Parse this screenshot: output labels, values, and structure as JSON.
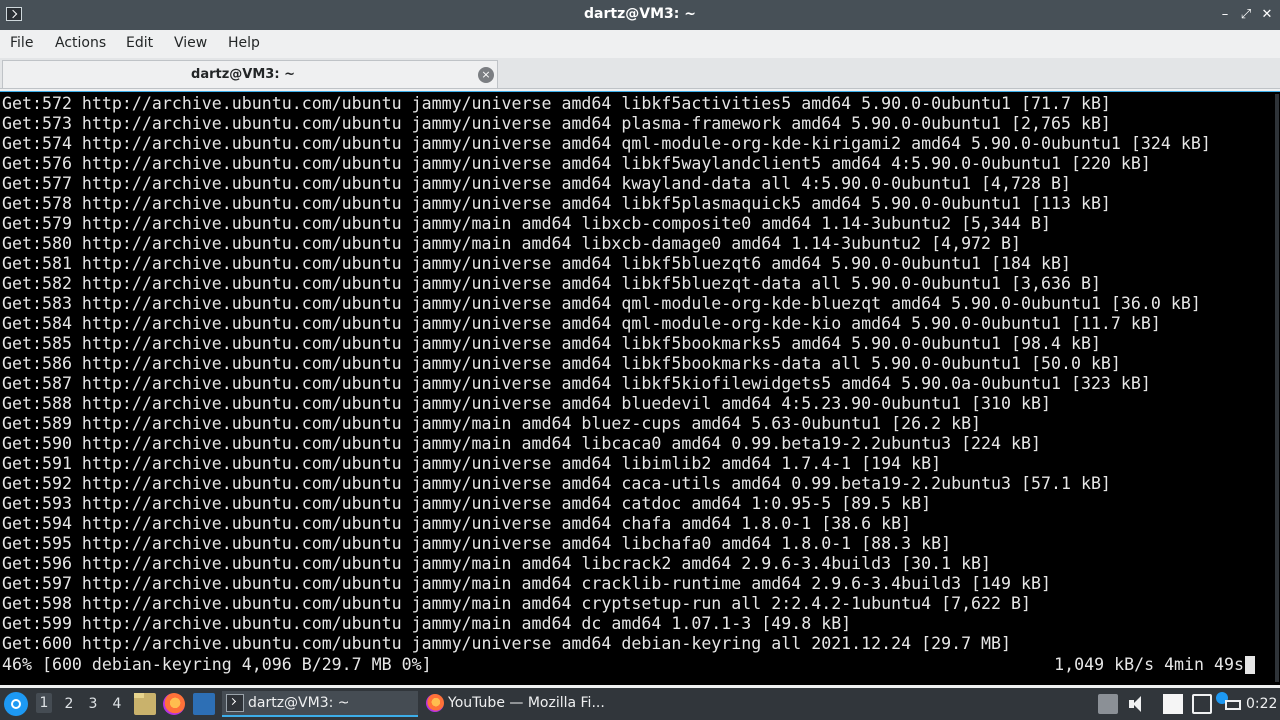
{
  "window": {
    "title": "dartz@VM3: ~"
  },
  "menu": [
    "File",
    "Actions",
    "Edit",
    "View",
    "Help"
  ],
  "tab": {
    "label": "dartz@VM3: ~",
    "close_glyph": "×"
  },
  "terminal": {
    "lines": [
      "Get:572 http://archive.ubuntu.com/ubuntu jammy/universe amd64 libkf5activities5 amd64 5.90.0-0ubuntu1 [71.7 kB]",
      "Get:573 http://archive.ubuntu.com/ubuntu jammy/universe amd64 plasma-framework amd64 5.90.0-0ubuntu1 [2,765 kB]",
      "Get:574 http://archive.ubuntu.com/ubuntu jammy/universe amd64 qml-module-org-kde-kirigami2 amd64 5.90.0-0ubuntu1 [324 kB]",
      "Get:576 http://archive.ubuntu.com/ubuntu jammy/universe amd64 libkf5waylandclient5 amd64 4:5.90.0-0ubuntu1 [220 kB]",
      "Get:577 http://archive.ubuntu.com/ubuntu jammy/universe amd64 kwayland-data all 4:5.90.0-0ubuntu1 [4,728 B]",
      "Get:578 http://archive.ubuntu.com/ubuntu jammy/universe amd64 libkf5plasmaquick5 amd64 5.90.0-0ubuntu1 [113 kB]",
      "Get:579 http://archive.ubuntu.com/ubuntu jammy/main amd64 libxcb-composite0 amd64 1.14-3ubuntu2 [5,344 B]",
      "Get:580 http://archive.ubuntu.com/ubuntu jammy/main amd64 libxcb-damage0 amd64 1.14-3ubuntu2 [4,972 B]",
      "Get:581 http://archive.ubuntu.com/ubuntu jammy/universe amd64 libkf5bluezqt6 amd64 5.90.0-0ubuntu1 [184 kB]",
      "Get:582 http://archive.ubuntu.com/ubuntu jammy/universe amd64 libkf5bluezqt-data all 5.90.0-0ubuntu1 [3,636 B]",
      "Get:583 http://archive.ubuntu.com/ubuntu jammy/universe amd64 qml-module-org-kde-bluezqt amd64 5.90.0-0ubuntu1 [36.0 kB]",
      "Get:584 http://archive.ubuntu.com/ubuntu jammy/universe amd64 qml-module-org-kde-kio amd64 5.90.0-0ubuntu1 [11.7 kB]",
      "Get:585 http://archive.ubuntu.com/ubuntu jammy/universe amd64 libkf5bookmarks5 amd64 5.90.0-0ubuntu1 [98.4 kB]",
      "Get:586 http://archive.ubuntu.com/ubuntu jammy/universe amd64 libkf5bookmarks-data all 5.90.0-0ubuntu1 [50.0 kB]",
      "Get:587 http://archive.ubuntu.com/ubuntu jammy/universe amd64 libkf5kiofilewidgets5 amd64 5.90.0a-0ubuntu1 [323 kB]",
      "Get:588 http://archive.ubuntu.com/ubuntu jammy/universe amd64 bluedevil amd64 4:5.23.90-0ubuntu1 [310 kB]",
      "Get:589 http://archive.ubuntu.com/ubuntu jammy/main amd64 bluez-cups amd64 5.63-0ubuntu1 [26.2 kB]",
      "Get:590 http://archive.ubuntu.com/ubuntu jammy/main amd64 libcaca0 amd64 0.99.beta19-2.2ubuntu3 [224 kB]",
      "Get:591 http://archive.ubuntu.com/ubuntu jammy/universe amd64 libimlib2 amd64 1.7.4-1 [194 kB]",
      "Get:592 http://archive.ubuntu.com/ubuntu jammy/universe amd64 caca-utils amd64 0.99.beta19-2.2ubuntu3 [57.1 kB]",
      "Get:593 http://archive.ubuntu.com/ubuntu jammy/universe amd64 catdoc amd64 1:0.95-5 [89.5 kB]",
      "Get:594 http://archive.ubuntu.com/ubuntu jammy/universe amd64 chafa amd64 1.8.0-1 [38.6 kB]",
      "Get:595 http://archive.ubuntu.com/ubuntu jammy/universe amd64 libchafa0 amd64 1.8.0-1 [88.3 kB]",
      "Get:596 http://archive.ubuntu.com/ubuntu jammy/main amd64 libcrack2 amd64 2.9.6-3.4build3 [30.1 kB]",
      "Get:597 http://archive.ubuntu.com/ubuntu jammy/main amd64 cracklib-runtime amd64 2.9.6-3.4build3 [149 kB]",
      "Get:598 http://archive.ubuntu.com/ubuntu jammy/main amd64 cryptsetup-run all 2:2.4.2-1ubuntu4 [7,622 B]",
      "Get:599 http://archive.ubuntu.com/ubuntu jammy/main amd64 dc amd64 1.07.1-3 [49.8 kB]",
      "Get:600 http://archive.ubuntu.com/ubuntu jammy/universe amd64 debian-keyring all 2021.12.24 [29.7 MB]"
    ],
    "status_left": "46% [600 debian-keyring 4,096 B/29.7 MB 0%]",
    "status_right": "1,049 kB/s 4min 49s"
  },
  "taskbar": {
    "desktops": [
      "1",
      "2",
      "3",
      "4"
    ],
    "active_desktop": "1",
    "tasks": [
      {
        "label": "dartz@VM3: ~",
        "icon": "terminal-icon"
      },
      {
        "label": "YouTube — Mozilla Fi...",
        "icon": "firefox-icon"
      }
    ],
    "clock": "0:22"
  }
}
